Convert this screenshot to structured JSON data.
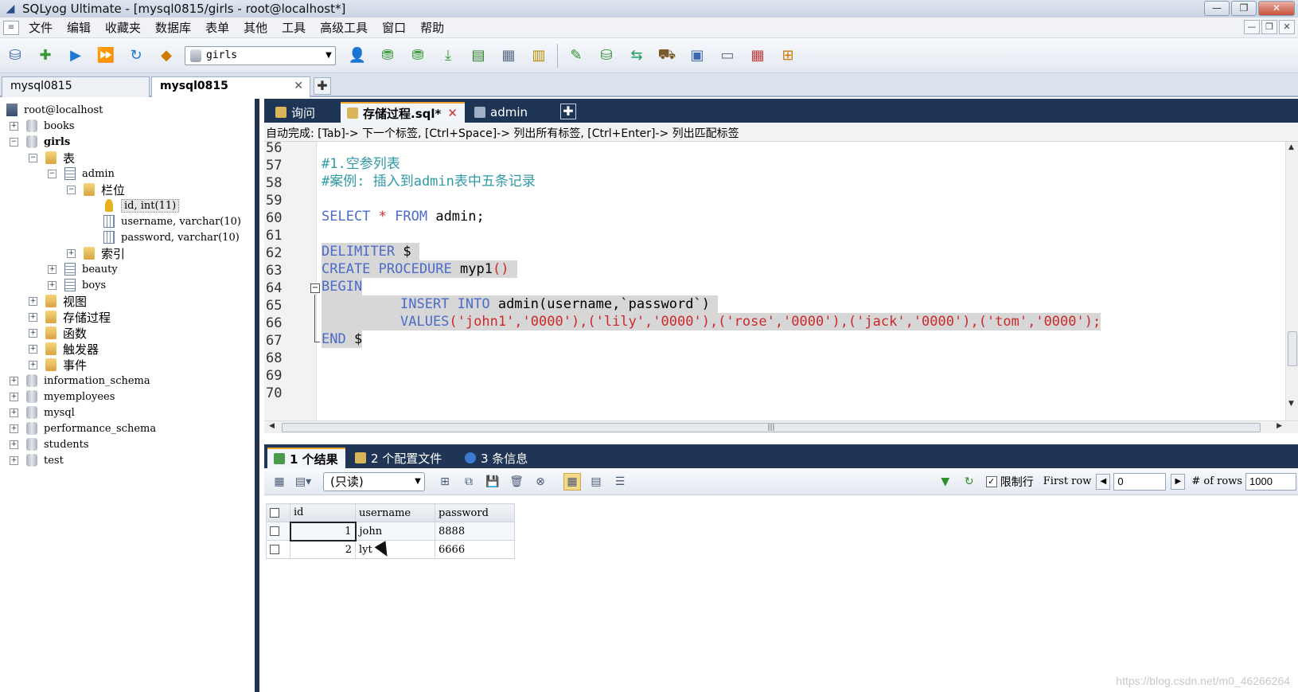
{
  "window": {
    "title": "SQLyog Ultimate - [mysql0815/girls - root@localhost*]",
    "controls": [
      "—",
      "❐",
      "✕"
    ]
  },
  "menubar": {
    "items": [
      "文件",
      "编辑",
      "收藏夹",
      "数据库",
      "表单",
      "其他",
      "工具",
      "高级工具",
      "窗口",
      "帮助"
    ]
  },
  "toolbar": {
    "db_select_value": "girls"
  },
  "connection_tabs": [
    {
      "label": "mysql0815",
      "active": false
    },
    {
      "label": "mysql0815",
      "active": true,
      "close": "✕"
    }
  ],
  "tree": {
    "root": "root@localhost",
    "items": [
      {
        "label": "books"
      },
      {
        "label": "girls"
      },
      {
        "label": "表"
      },
      {
        "label": "admin"
      },
      {
        "label": "栏位"
      },
      {
        "label": "id, int(11)"
      },
      {
        "label": "username, varchar(10)"
      },
      {
        "label": "password, varchar(10)"
      },
      {
        "label": "索引"
      },
      {
        "label": "beauty"
      },
      {
        "label": "boys"
      },
      {
        "label": "视图"
      },
      {
        "label": "存储过程"
      },
      {
        "label": "函数"
      },
      {
        "label": "触发器"
      },
      {
        "label": "事件"
      },
      {
        "label": "information_schema"
      },
      {
        "label": "myemployees"
      },
      {
        "label": "mysql"
      },
      {
        "label": "performance_schema"
      },
      {
        "label": "students"
      },
      {
        "label": "test"
      }
    ]
  },
  "query_tabs": [
    {
      "label": "询问"
    },
    {
      "label": "存储过程.sql*",
      "close": "✕"
    },
    {
      "label": "admin"
    }
  ],
  "autocomplete_hint": "自动完成: [Tab]-> 下一个标签, [Ctrl+Space]-> 列出所有标签, [Ctrl+Enter]-> 列出匹配标签",
  "editor": {
    "line_numbers": [
      "56",
      "57",
      "58",
      "59",
      "60",
      "61",
      "62",
      "63",
      "64",
      "65",
      "66",
      "67",
      "68",
      "69",
      "70"
    ],
    "lines": {
      "l57": "#1.空参列表",
      "l58": "#案例: 插入到admin表中五条记录",
      "l60_kw1": "SELECT",
      "l60_star": " * ",
      "l60_kw2": "FROM",
      "l60_rest": " admin;",
      "l62_kw": "DELIMITER",
      "l62_rest": " $ ",
      "l63_kw": "CREATE PROCEDURE",
      "l63_rest": " myp1",
      "l63_paren": "() ",
      "l64_kw": "BEGIN",
      "l65_kw": "INSERT INTO",
      "l65_rest": " admin(username,`password`) ",
      "l66_kw": "VALUES",
      "l66_rest": "('john1','0000'),('lily','0000'),('rose','0000'),('jack','0000'),('tom','0000');",
      "l67_kw": "END",
      "l67_rest": " $"
    }
  },
  "result_tabs": [
    {
      "label": "1 个结果"
    },
    {
      "label": "2 个配置文件"
    },
    {
      "label": "3 条信息"
    }
  ],
  "result_toolbar": {
    "readonly_select": "(只读)",
    "limit_label": "限制行",
    "first_row_label": "First row",
    "first_row_value": "0",
    "rows_label": "# of rows",
    "rows_value": "1000"
  },
  "result_grid": {
    "columns": [
      "id",
      "username",
      "password"
    ],
    "rows": [
      {
        "id": "1",
        "username": "john",
        "password": "8888"
      },
      {
        "id": "2",
        "username": "lyt",
        "password": "6666"
      }
    ]
  },
  "watermark": "https://blog.csdn.net/m0_46266264"
}
